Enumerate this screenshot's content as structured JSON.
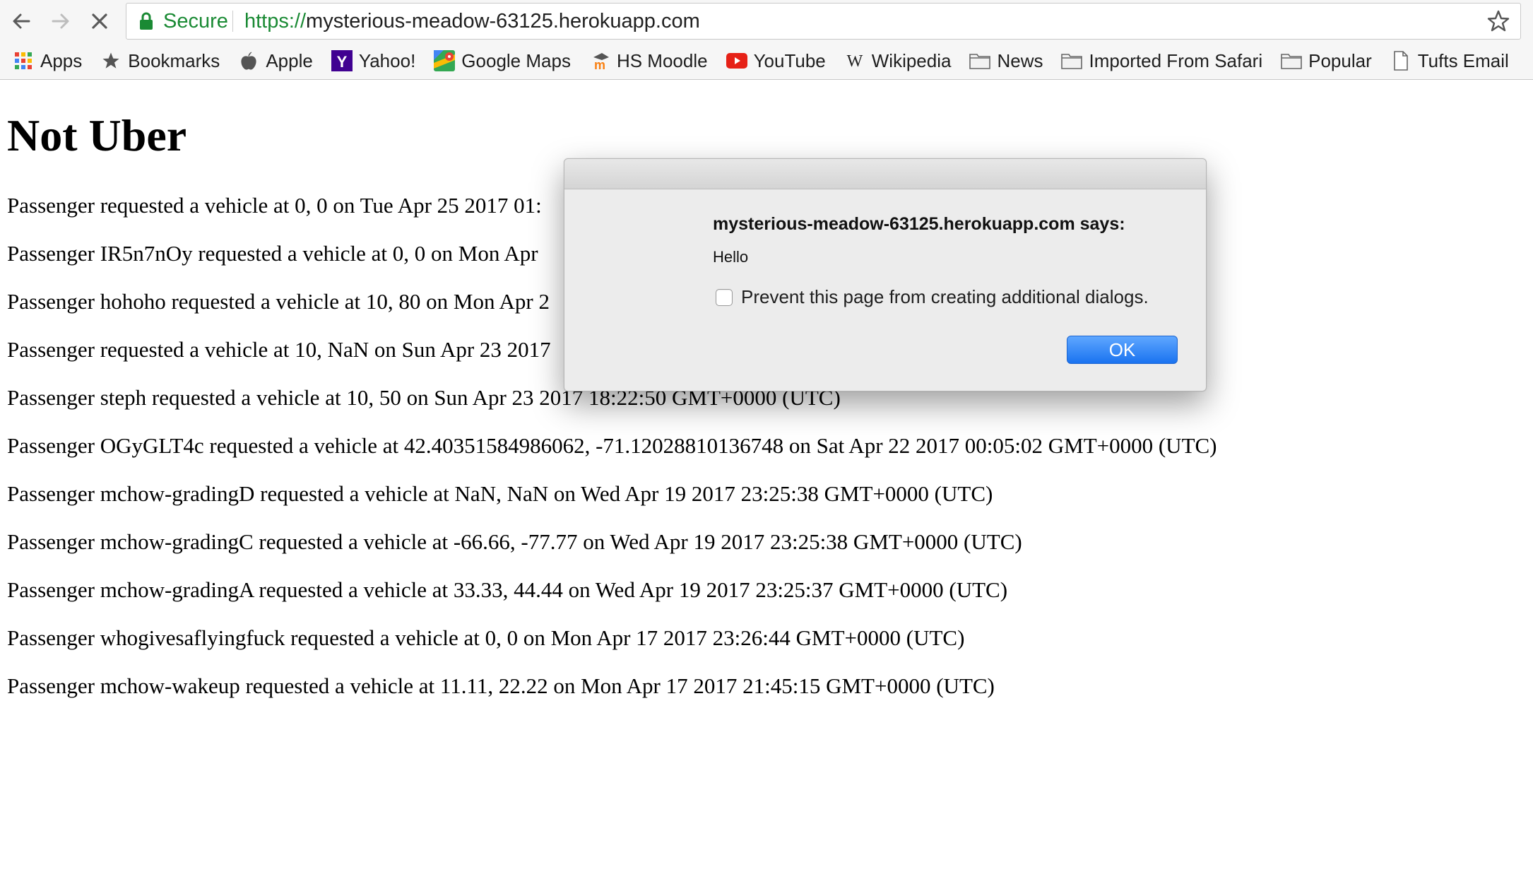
{
  "browser": {
    "secure_label": "Secure",
    "url_protocol": "https://",
    "url_host": "mysterious-meadow-63125.herokuapp.com",
    "bookmarks": [
      {
        "label": "Apps",
        "icon": "apps-grid-icon"
      },
      {
        "label": "Bookmarks",
        "icon": "star-icon"
      },
      {
        "label": "Apple",
        "icon": "apple-icon"
      },
      {
        "label": "Yahoo!",
        "icon": "yahoo-icon"
      },
      {
        "label": "Google Maps",
        "icon": "google-maps-icon"
      },
      {
        "label": "HS Moodle",
        "icon": "moodle-icon"
      },
      {
        "label": "YouTube",
        "icon": "youtube-icon"
      },
      {
        "label": "Wikipedia",
        "icon": "wikipedia-icon"
      },
      {
        "label": "News",
        "icon": "folder-icon"
      },
      {
        "label": "Imported From Safari",
        "icon": "folder-icon"
      },
      {
        "label": "Popular",
        "icon": "folder-icon"
      },
      {
        "label": "Tufts Email",
        "icon": "page-icon"
      }
    ]
  },
  "page": {
    "title": "Not Uber",
    "requests": [
      "Passenger requested a vehicle at 0, 0 on Tue Apr 25 2017 01:",
      "Passenger IR5n7nOy requested a vehicle at 0, 0 on Mon Apr",
      "Passenger hohoho requested a vehicle at 10, 80 on Mon Apr 2",
      "Passenger requested a vehicle at 10, NaN on Sun Apr 23 2017",
      "Passenger steph requested a vehicle at 10, 50 on Sun Apr 23 2017 18:22:50 GMT+0000 (UTC)",
      "Passenger OGyGLT4c requested a vehicle at 42.40351584986062, -71.12028810136748 on Sat Apr 22 2017 00:05:02 GMT+0000 (UTC)",
      "Passenger mchow-gradingD requested a vehicle at NaN, NaN on Wed Apr 19 2017 23:25:38 GMT+0000 (UTC)",
      "Passenger mchow-gradingC requested a vehicle at -66.66, -77.77 on Wed Apr 19 2017 23:25:38 GMT+0000 (UTC)",
      "Passenger mchow-gradingA requested a vehicle at 33.33, 44.44 on Wed Apr 19 2017 23:25:37 GMT+0000 (UTC)",
      "Passenger whogivesaflyingfuck requested a vehicle at 0, 0 on Mon Apr 17 2017 23:26:44 GMT+0000 (UTC)",
      "Passenger mchow-wakeup requested a vehicle at 11.11, 22.22 on Mon Apr 17 2017 21:45:15 GMT+0000 (UTC)"
    ]
  },
  "dialog": {
    "heading": "mysterious-meadow-63125.herokuapp.com says:",
    "message": "Hello",
    "checkbox_label": "Prevent this page from creating additional dialogs.",
    "ok_label": "OK"
  },
  "colors": {
    "secure_green": "#1a8a34",
    "ok_button_blue": "#1a73f0",
    "youtube_red": "#e62117",
    "yahoo_purple": "#400191"
  }
}
